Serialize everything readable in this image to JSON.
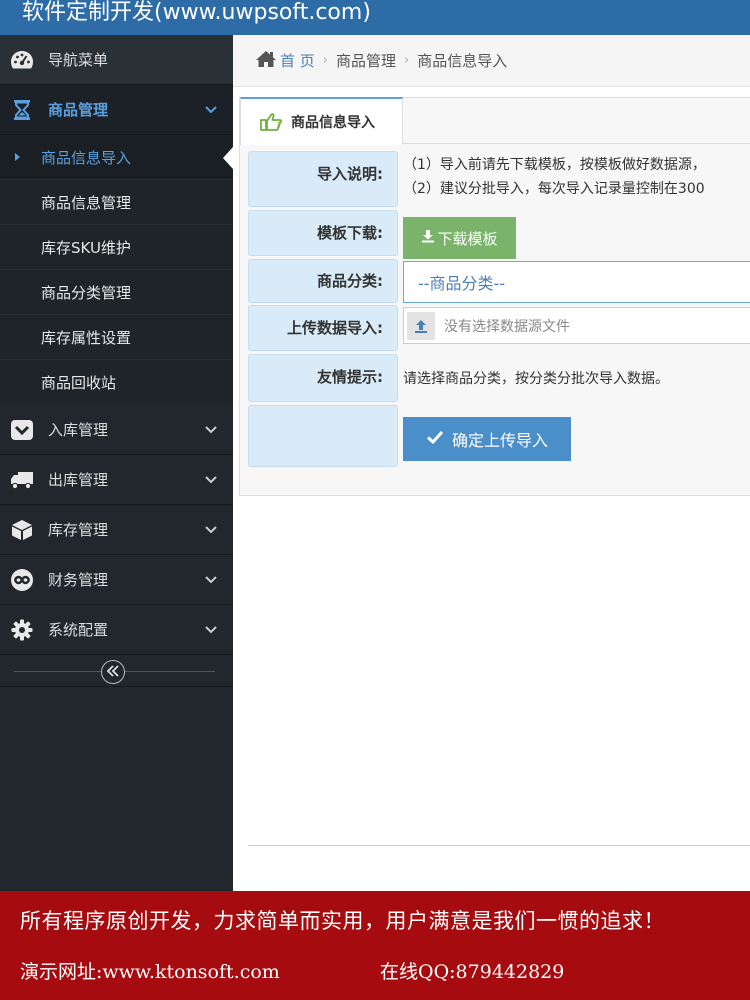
{
  "header": {
    "brand": "软件定制开发(www.uwpsoft.com)"
  },
  "sidebar": {
    "nav_title": {
      "label": "导航菜单",
      "icon": "dashboard-icon"
    },
    "goods": {
      "label": "商品管理",
      "icon": "hourglass-icon",
      "sub_items": [
        {
          "label": "商品信息导入"
        },
        {
          "label": "商品信息管理"
        },
        {
          "label": "库存SKU维护"
        },
        {
          "label": "商品分类管理"
        },
        {
          "label": "库存属性设置"
        },
        {
          "label": "商品回收站"
        }
      ]
    },
    "menus": [
      {
        "label": "入库管理",
        "icon": "inbox-icon"
      },
      {
        "label": "出库管理",
        "icon": "truck-icon"
      },
      {
        "label": "库存管理",
        "icon": "cube-icon"
      },
      {
        "label": "财务管理",
        "icon": "finance-icon"
      },
      {
        "label": "系统配置",
        "icon": "gear-icon"
      }
    ],
    "collapse_icon": "double-chevron-left-icon"
  },
  "breadcrumb": {
    "home": "首 页",
    "items": [
      "商品管理",
      "商品信息导入"
    ]
  },
  "panel": {
    "tab": "商品信息导入",
    "rows": {
      "instructions": {
        "label": "导入说明:",
        "lines": [
          "（1）导入前请先下载模板，按模板做好数据源，",
          "（2）建议分批导入，每次导入记录量控制在300"
        ]
      },
      "template": {
        "label": "模板下载:",
        "button": "下载模板"
      },
      "category": {
        "label": "商品分类:",
        "placeholder": "--商品分类--"
      },
      "upload": {
        "label": "上传数据导入:",
        "placeholder": "没有选择数据源文件"
      },
      "tip": {
        "label": "友情提示:",
        "text": "请选择商品分类，按分类分批次导入数据。"
      },
      "submit": {
        "button": "确定上传导入"
      }
    }
  },
  "footer": {
    "slogan": "所有程序原创开发，力求简单而实用，用户满意是我们一惯的追求！",
    "site": "演示网址:www.ktonsoft.com",
    "qq": "在线QQ:879442829"
  },
  "colors": {
    "header_bg": "#2d6ca6",
    "sidebar_bg": "#21272c",
    "active_accent": "#5aa0e0",
    "label_bg": "#d9ebf8",
    "download_button": "#79b46a",
    "submit_button": "#4a8fc9",
    "footer_bg": "#a60b10"
  }
}
